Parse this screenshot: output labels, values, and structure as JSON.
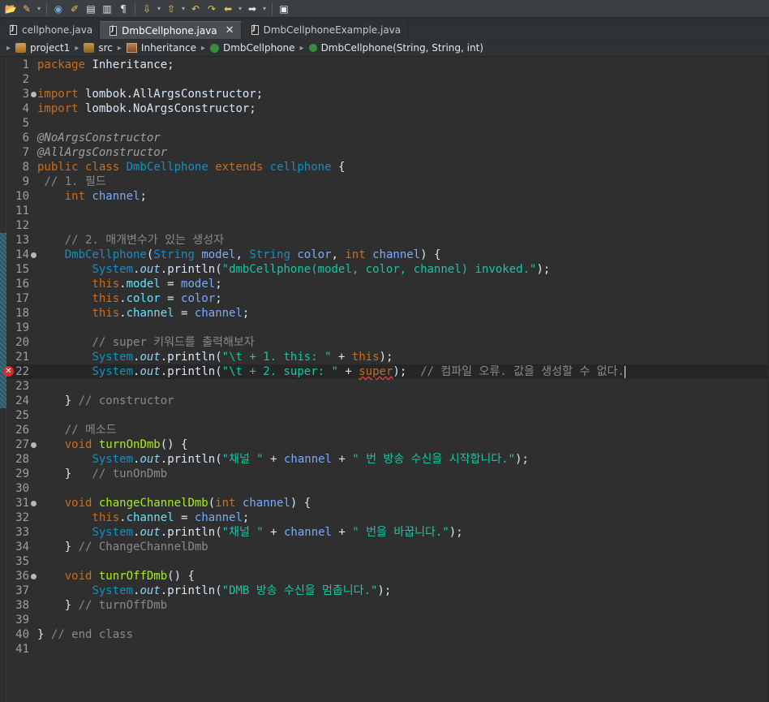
{
  "tabs": [
    {
      "label": "cellphone.java",
      "active": false
    },
    {
      "label": "DmbCellphone.java",
      "active": true
    },
    {
      "label": "DmbCellphoneExample.java",
      "active": false
    }
  ],
  "breadcrumb": [
    "project1",
    "src",
    "Inheritance",
    "DmbCellphone",
    "DmbCellphone(String, String, int)"
  ],
  "lines": [
    "package Inheritance;",
    "",
    "import lombok.AllArgsConstructor;",
    "import lombok.NoArgsConstructor;",
    "",
    "@NoArgsConstructor",
    "@AllArgsConstructor",
    "public class DmbCellphone extends cellphone {",
    " // 1. 필드",
    "    int channel;",
    "",
    "",
    "    // 2. 매개변수가 있는 생성자",
    "    DmbCellphone(String model, String color, int channel) {",
    "        System.out.println(\"dmbCellphone(model, color, channel) invoked.\");",
    "        this.model = model;",
    "        this.color = color;",
    "        this.channel = channel;",
    "",
    "        // super 키워드를 출력해보자",
    "        System.out.println(\"\\t + 1. this: \" + this);",
    "        System.out.println(\"\\t + 2. super: \" + super);  // 컴파일 오류. 값을 생성할 수 없다.",
    "",
    "    } // constructor",
    "",
    "    // 메소드",
    "    void turnOnDmb() {",
    "        System.out.println(\"채널 \" + channel + \" 번 방송 수신을 시작합니다.\");",
    "    }   // tunOnDmb",
    "",
    "    void changeChannelDmb(int channel) {",
    "        this.channel = channel;",
    "        System.out.println(\"채널 \" + channel + \" 번을 바꿉니다.\");",
    "    } // ChangeChannelDmb",
    "",
    "    void tunrOffDmb() {",
    "        System.out.println(\"DMB 방송 수신을 멈춥니다.\");",
    "    } // turnOffDmb",
    "",
    "} // end class",
    ""
  ],
  "fold_lines": [
    3,
    14,
    27,
    31,
    36
  ],
  "error_line": 22,
  "colors": {
    "keyword": "#cc6c1d",
    "class_name": "#1290c3",
    "string": "#17c6a3",
    "comment": "#8a8a8a",
    "field": "#66e1f8",
    "method": "#a7ec21"
  }
}
